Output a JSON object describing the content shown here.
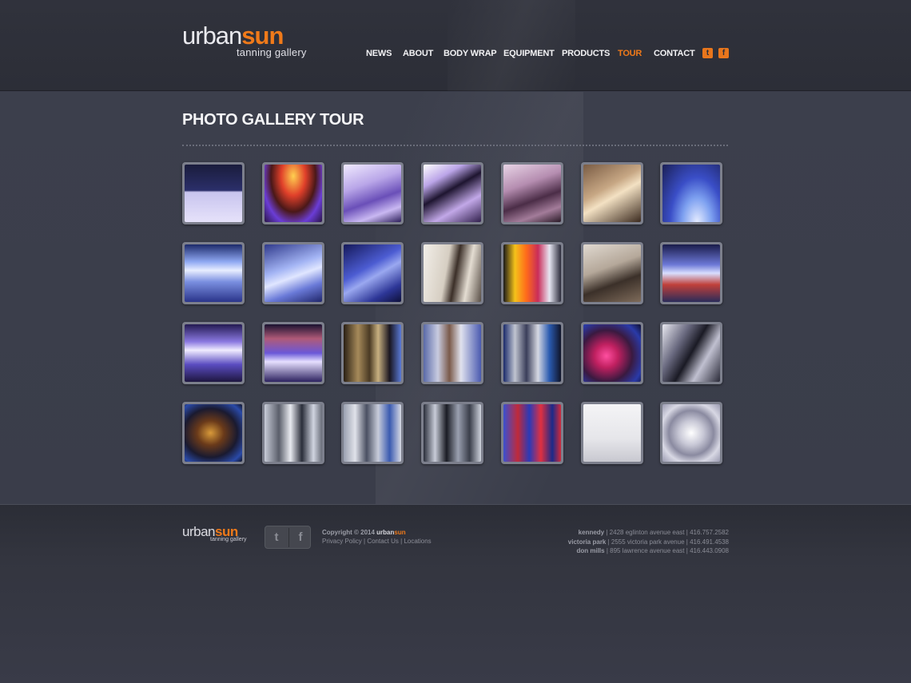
{
  "brand": {
    "logo_a": "urban",
    "logo_b": "sun",
    "tagline": "tanning gallery"
  },
  "nav": [
    {
      "label": "NEWS",
      "active": false
    },
    {
      "label": "ABOUT",
      "active": false
    },
    {
      "label": "BODY WRAP",
      "active": false
    },
    {
      "label": "EQUIPMENT",
      "active": false
    },
    {
      "label": "PRODUCTS",
      "active": false
    },
    {
      "label": "TOUR",
      "active": true
    },
    {
      "label": "CONTACT",
      "active": false
    }
  ],
  "social": {
    "twitter_icon": "twitter-icon",
    "facebook_icon": "facebook-icon",
    "accent": "#f07a1a"
  },
  "page": {
    "title": "PHOTO GALLERY TOUR"
  },
  "gallery": [
    {
      "name": "retail-shelf-display",
      "bg": "linear-gradient(180deg,#1a1c3c 0%,#2b2f6a 45%,#c8c4ee 48%,#e6e2fa 100%)"
    },
    {
      "name": "tanning-bed-orange-glow",
      "bg": "radial-gradient(ellipse at 50% 20%,#ffd050 0%,#e0402a 30%,#4a1818 55%,#6b3dd6 75%,#2a1548 100%)"
    },
    {
      "name": "tanning-bed-open-white",
      "bg": "linear-gradient(160deg,#f0eaff 0%,#b9a6e8 35%,#6a4fb8 60%,#c9b8f2 80%,#2d1f5a 100%)"
    },
    {
      "name": "tanning-bed-lid-black",
      "bg": "linear-gradient(150deg,#ffffff 0%,#bba5e8 25%,#1e1530 45%,#c2a8e8 70%,#31204c 100%)"
    },
    {
      "name": "tanning-bed-pink-room",
      "bg": "linear-gradient(160deg,#e8d4e6 0%,#b58db0 35%,#4b2d47 60%,#a37c9a 80%,#2a1a27 100%)"
    },
    {
      "name": "tanning-room-beige",
      "bg": "linear-gradient(150deg,#7a5c44 0%,#c7a784 40%,#f3e1c3 55%,#3b2a1f 100%)"
    },
    {
      "name": "tanning-bed-blue-arch",
      "bg": "radial-gradient(ellipse at 60% 100%,#e6ecff 0%,#7da0f0 30%,#3a4ec7 55%,#1a1f55 100%)"
    },
    {
      "name": "tanning-bed-tubes-blue-1",
      "bg": "linear-gradient(180deg,#1c2a6a 0%,#8fa8f2 30%,#e8eeff 45%,#7a8fe0 65%,#2a348a 100%)"
    },
    {
      "name": "tanning-bed-tubes-blue-2",
      "bg": "linear-gradient(160deg,#303a8c 0%,#a3b4f4 40%,#e0e6ff 55%,#6a7ad8 75%,#20266a 100%)"
    },
    {
      "name": "tanning-bed-tubes-blue-3",
      "bg": "linear-gradient(150deg,#15195a 0%,#4c5cd2 40%,#9aa8f0 55%,#2d3697 80%,#0e103a 100%)"
    },
    {
      "name": "hallway-with-vase",
      "bg": "linear-gradient(100deg,#f2eee8 0%,#d6cec2 40%,#3b2f28 55%,#e4ddd2 75%,#5a5048 100%)"
    },
    {
      "name": "colorful-glass-wall",
      "bg": "linear-gradient(90deg,#1a1a1a 0%,#f5c21a 20%,#ff6a1a 40%,#c92d5a 60%,#e6e6f2 80%,#2a2a3a 100%)"
    },
    {
      "name": "reed-diffuser-decor",
      "bg": "linear-gradient(160deg,#e0d9d0 0%,#b5a89a 40%,#3b3029 65%,#7e6b5a 100%)"
    },
    {
      "name": "tanning-bed-side-view",
      "bg": "linear-gradient(180deg,#1a1c4a 0%,#6c78d6 35%,#d8deff 50%,#c0403a 70%,#2a2c5a 100%)"
    },
    {
      "name": "tanning-bed-tubes-purple-1",
      "bg": "linear-gradient(180deg,#231a52 0%,#8a78e0 30%,#f0ecff 45%,#5a4cc0 70%,#1e1640 100%)"
    },
    {
      "name": "tanning-bed-tubes-purple-2",
      "bg": "linear-gradient(180deg,#1a1230 0%,#b05a78 25%,#6a58d8 50%,#e6e0ff 65%,#2d2260 100%)"
    },
    {
      "name": "product-bottles-gold",
      "bg": "linear-gradient(90deg,#2a1f14 0%,#a68a5a 25%,#4a3a24 45%,#c8b080 60%,#1a1620 80%,#5a7ad8 100%)"
    },
    {
      "name": "product-bottles-blue",
      "bg": "linear-gradient(90deg,#5a6aa8 0%,#c8cbe0 25%,#7a5a4a 45%,#e0e2ee 65%,#4a5ab0 100%)"
    },
    {
      "name": "product-bottles-row",
      "bg": "linear-gradient(90deg,#1a2a6a 0%,#c0c4d0 20%,#3a3e5a 40%,#d6d8e2 60%,#2a5ab0 80%,#101428 100%)"
    },
    {
      "name": "product-bottles-pink",
      "bg": "radial-gradient(circle at 40% 55%,#ff4fa0 0%,#c02060 25%,#3a1a40 55%,#2a3aa8 80%,#101030 100%)"
    },
    {
      "name": "product-bottles-chrome",
      "bg": "linear-gradient(120deg,#e8e8f0 0%,#6a6a80 30%,#1a1a24 50%,#c0c0d0 70%,#2a2a38 100%)"
    },
    {
      "name": "product-gold-bottle",
      "bg": "radial-gradient(ellipse at 45% 50%,#d89a3a 0%,#6a3a1a 30%,#1a1a30 60%,#2a4aa8 85%,#101428 100%)"
    },
    {
      "name": "lotion-tubes-silver-1",
      "bg": "linear-gradient(90deg,#c8ccd8 0%,#5a5e6a 25%,#e8eaf0 45%,#2a2e3a 65%,#d0d4e0 85%,#6a6e7a 100%)"
    },
    {
      "name": "lotion-tubes-silver-2",
      "bg": "linear-gradient(90deg,#9aa0b0 0%,#e0e2ea 20%,#4a5062 40%,#c8ccda 60%,#3a5ab0 80%,#d8dae4 100%)"
    },
    {
      "name": "lotion-tubes-dark",
      "bg": "linear-gradient(90deg,#2a2e3a 0%,#c8ccd8 20%,#1a1c24 40%,#9aa0b0 60%,#3a3e4a 80%,#d0d4de 100%)"
    },
    {
      "name": "energy-bottles",
      "bg": "linear-gradient(90deg,#3a50d0 0%,#c02a3a 25%,#2a3ab8 45%,#e03040 65%,#1a2a8a 85%,#d02a3a 100%)"
    },
    {
      "name": "urbansun-wall-logo",
      "bg": "linear-gradient(180deg,#f4f4f6 0%,#e6e6ea 60%,#c8c8d0 100%)"
    },
    {
      "name": "crystal-chandelier",
      "bg": "radial-gradient(circle at 50% 50%,#ffffff 0%,#c8c8d6 30%,#8a8aa0 55%,#d8d8e4 75%,#9a9ab0 100%)"
    }
  ],
  "footer": {
    "copyright_prefix": "Copyright © 2014 ",
    "copyright_brand_a": "urban",
    "copyright_brand_b": "sun",
    "links": [
      "Privacy Policy",
      "Contact Us",
      "Locations"
    ],
    "locations": [
      {
        "name": "kennedy",
        "address": "2428 eglinton avenue east",
        "phone": "416.757.2582"
      },
      {
        "name": "victoria park",
        "address": "2555 victoria park avenue",
        "phone": "416.491.4538"
      },
      {
        "name": "don mills",
        "address": "895 lawrence avenue east",
        "phone": "416.443.0908"
      }
    ]
  }
}
